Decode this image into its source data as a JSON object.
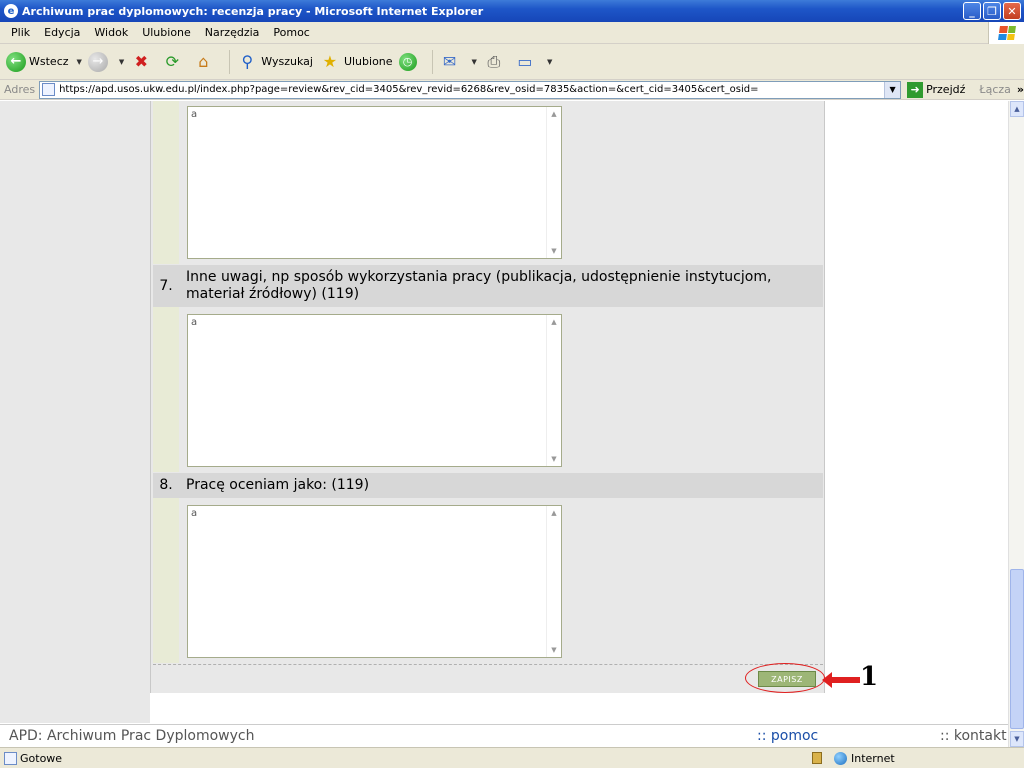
{
  "window": {
    "title": "Archiwum prac dyplomowych: recenzja pracy - Microsoft Internet Explorer"
  },
  "menu": [
    "Plik",
    "Edycja",
    "Widok",
    "Ulubione",
    "Narzędzia",
    "Pomoc"
  ],
  "toolbar": {
    "back_label": "Wstecz",
    "search_label": "Wyszukaj",
    "favorites_label": "Ulubione"
  },
  "address": {
    "label": "Adres",
    "url": "https://apd.usos.ukw.edu.pl/index.php?page=review&rev_cid=3405&rev_revid=6268&rev_osid=7835&action=&cert_cid=3405&cert_osid=",
    "go_label": "Przejdź",
    "links_label": "Łącza"
  },
  "questions": [
    {
      "number": "",
      "text": "",
      "answer": "a"
    },
    {
      "number": "7.",
      "text": "Inne uwagi, np sposób wykorzystania pracy (publikacja, udostępnienie instytucjom, materiał źródłowy) (119)",
      "answer": "a"
    },
    {
      "number": "8.",
      "text": "Pracę oceniam jako: (119)",
      "answer": "a"
    }
  ],
  "save_button": "ZAPISZ",
  "annotation_number": "1",
  "footer": {
    "brand": "APD: Archiwum Prac Dyplomowych",
    "help": ":: pomoc",
    "contact": ":: kontakt"
  },
  "status": {
    "text": "Gotowe",
    "zone": "Internet"
  }
}
